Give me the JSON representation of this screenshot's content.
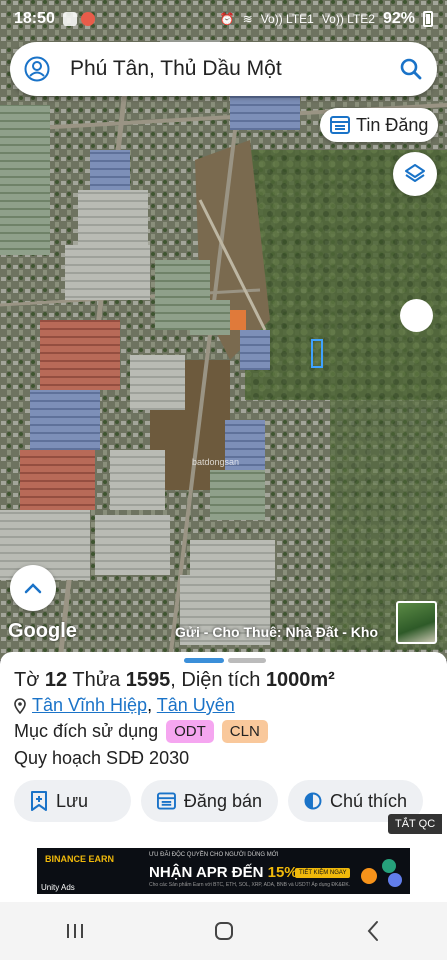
{
  "status_bar": {
    "time": "18:50",
    "network_1": "Vo)) LTE1",
    "network_2": "Vo)) LTE2",
    "battery": "92%"
  },
  "search": {
    "query": "Phú Tân, Thủ Dầu Một"
  },
  "map": {
    "tin_dang_label": "Tin Đăng",
    "google_logo": "Google",
    "watermark": "batdongsan",
    "ad_caption": "Gửi - Cho Thuê: Nhà Đất - Kho"
  },
  "parcel": {
    "to_label": "Tờ",
    "to_value": "12",
    "thua_label": "Thửa",
    "thua_value": "1595",
    "area_label": ", Diện tích",
    "area_value": "1000m²",
    "ward": "Tân Vĩnh Hiệp",
    "separator": ",",
    "district": "Tân Uyên",
    "purpose_label": "Mục đích sử dụng",
    "tags": [
      "ODT",
      "CLN"
    ],
    "plan": "Quy hoạch SDĐ 2030"
  },
  "actions": {
    "save": "Lưu",
    "post": "Đăng bán",
    "note": "Chú thích"
  },
  "ad": {
    "close_label": "TẮT QC",
    "brand": "BINANCE EARN",
    "small": "ƯU ĐÃI ĐỘC QUYỀN CHO NGƯỜI DÙNG MỚI",
    "headline_a": "NHẬN APR ĐẾN ",
    "headline_b": "15%",
    "cta": "TIẾT KIỆM NGAY",
    "fine": "Cho các Sản phẩm Earn với BTC, ETH, SOL, XRP, ADA, BNB và USDT! Áp dụng ĐK&ĐK.",
    "unity": "Unity Ads"
  },
  "colors": {
    "link": "#1a73c8",
    "tag_odt": "#f5a6f0",
    "tag_cln": "#f9c89b",
    "handle": "#3b8fd9"
  }
}
